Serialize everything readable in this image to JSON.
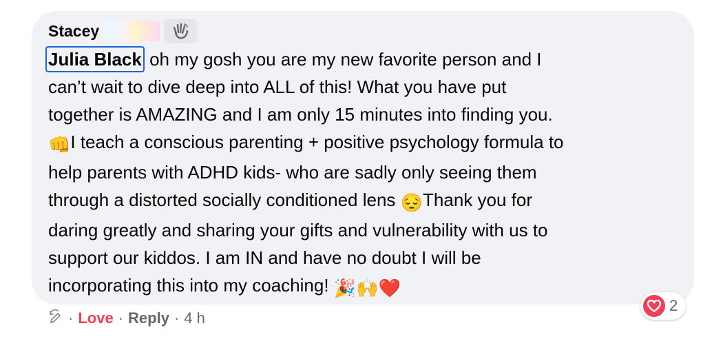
{
  "comment": {
    "author": "Stacey",
    "mention": "Julia Black",
    "line1": " oh my gosh you are my new favorite person and I",
    "line2": "can’t wait to dive deep into ALL of this! What you have put",
    "line3": "together is AMAZING and I am only 15 minutes into finding you.",
    "line4_emoji": "👊",
    "line4": "I teach a conscious parenting + positive psychology formula to",
    "line5": "help parents with ADHD kids- who are sadly only seeing them",
    "line6a": "through a distorted socially conditioned lens ",
    "line6_emoji": "😔",
    "line6b": "Thank you for",
    "line7": "daring greatly and sharing your gifts and vulnerability with us to",
    "line8": "support our kiddos. I am IN and have no doubt I will be",
    "line9": "incorporating this into my coaching! ",
    "line9_emojis": "🎉🙌❤️"
  },
  "icons": {
    "author_badge": "waving-hand-icon",
    "edit_history": "edit-history-icon",
    "reaction": "heart-icon"
  },
  "actions": {
    "separator": "·",
    "love_label": "Love",
    "reply_label": "Reply",
    "timestamp": "4 h"
  },
  "reactions": {
    "count": "2"
  },
  "colors": {
    "bubble": "#f0f2f5",
    "love": "#f33e58",
    "mention_outline": "#1a63d8",
    "meta_text": "#65676b"
  }
}
